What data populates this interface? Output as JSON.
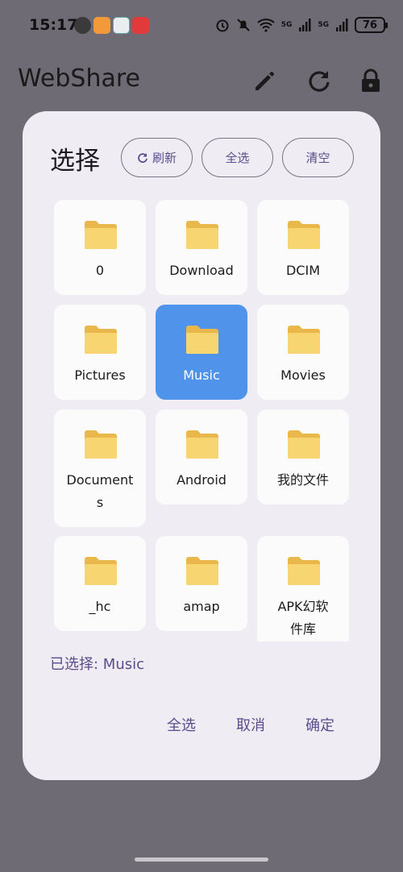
{
  "status_bar": {
    "time": "15:17",
    "battery": "76",
    "network_1": "5G",
    "network_2": "5G"
  },
  "app_bar": {
    "title": "WebShare",
    "icons": [
      "edit-icon",
      "refresh-icon",
      "lock-icon"
    ]
  },
  "dialog": {
    "title": "选择",
    "refresh_label": "刷新",
    "select_all_label": "全选",
    "clear_label": "清空",
    "folders": [
      {
        "name": "0",
        "selected": false
      },
      {
        "name": "Download",
        "selected": false
      },
      {
        "name": "DCIM",
        "selected": false
      },
      {
        "name": "Pictures",
        "selected": false
      },
      {
        "name": "Music",
        "selected": true
      },
      {
        "name": "Movies",
        "selected": false
      },
      {
        "name": "Documents",
        "selected": false
      },
      {
        "name": "Android",
        "selected": false
      },
      {
        "name": "我的文件",
        "selected": false
      },
      {
        "name": "_hc",
        "selected": false
      },
      {
        "name": "amap",
        "selected": false
      },
      {
        "name": "APK幻软件库",
        "selected": false
      }
    ],
    "selected_label": "已选择: Music",
    "actions": {
      "select_all": "全选",
      "cancel": "取消",
      "confirm": "确定"
    }
  },
  "colors": {
    "accent": "#5a4c8c",
    "selected_tile": "#4f93ea",
    "dialog_bg": "#f0ecf4",
    "scrim": "#6f6b74",
    "folder": "#f7cf63"
  }
}
